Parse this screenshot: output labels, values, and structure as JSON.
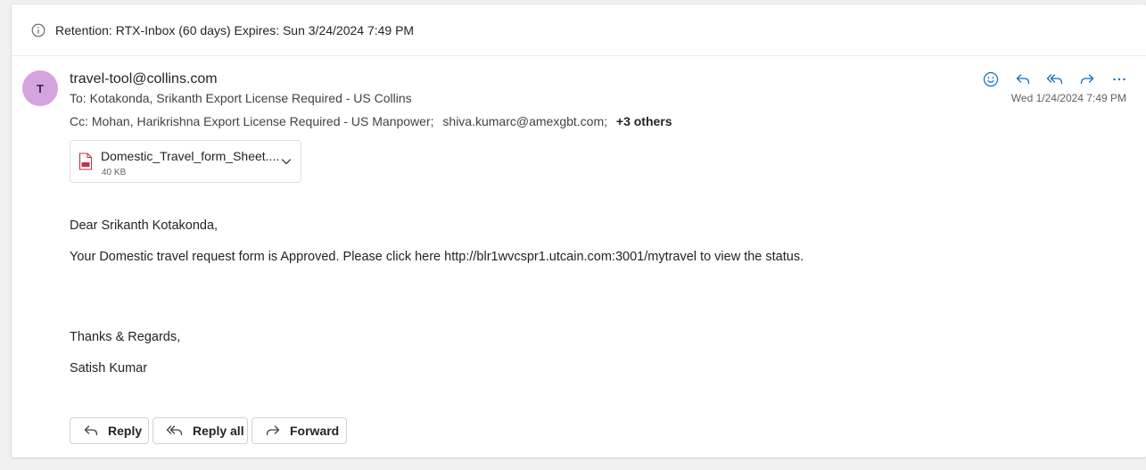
{
  "retention": {
    "text": "Retention: RTX-Inbox (60 days) Expires: Sun 3/24/2024 7:49 PM"
  },
  "message": {
    "avatar_initial": "T",
    "sender": "travel-tool@collins.com",
    "to_label": "To:",
    "to_value": "Kotakonda, Srikanth Export License Required - US Collins",
    "cc_label": "Cc:",
    "cc_recipient_1": "Mohan, Harikrishna Export License Required - US Manpower;",
    "cc_recipient_2": "shiva.kumarc@amexgbt.com;",
    "cc_others": "+3 others",
    "date": "Wed 1/24/2024 7:49 PM"
  },
  "attachment": {
    "name": "Domestic_Travel_form_Sheet....",
    "size": "40 KB"
  },
  "body": {
    "greeting": "Dear Srikanth Kotakonda,",
    "line1": "Your Domestic travel request form is Approved. Please click here http://blr1wvcspr1.utcain.com:3001/mytravel to view the status.",
    "closing": "Thanks & Regards,",
    "signature": "Satish Kumar"
  },
  "buttons": {
    "reply": "Reply",
    "reply_all": "Reply all",
    "forward": "Forward"
  },
  "icons": {
    "info": "info-icon",
    "emoji": "emoji-icon",
    "reply": "reply-icon",
    "reply_all": "reply-all-icon",
    "forward": "forward-icon",
    "more": "more-icon",
    "pdf": "pdf-file-icon",
    "chevron": "chevron-down-icon"
  },
  "colors": {
    "accent": "#0f6cbd",
    "avatar_bg": "#d3a4dd",
    "pdf_red": "#c4314b"
  }
}
